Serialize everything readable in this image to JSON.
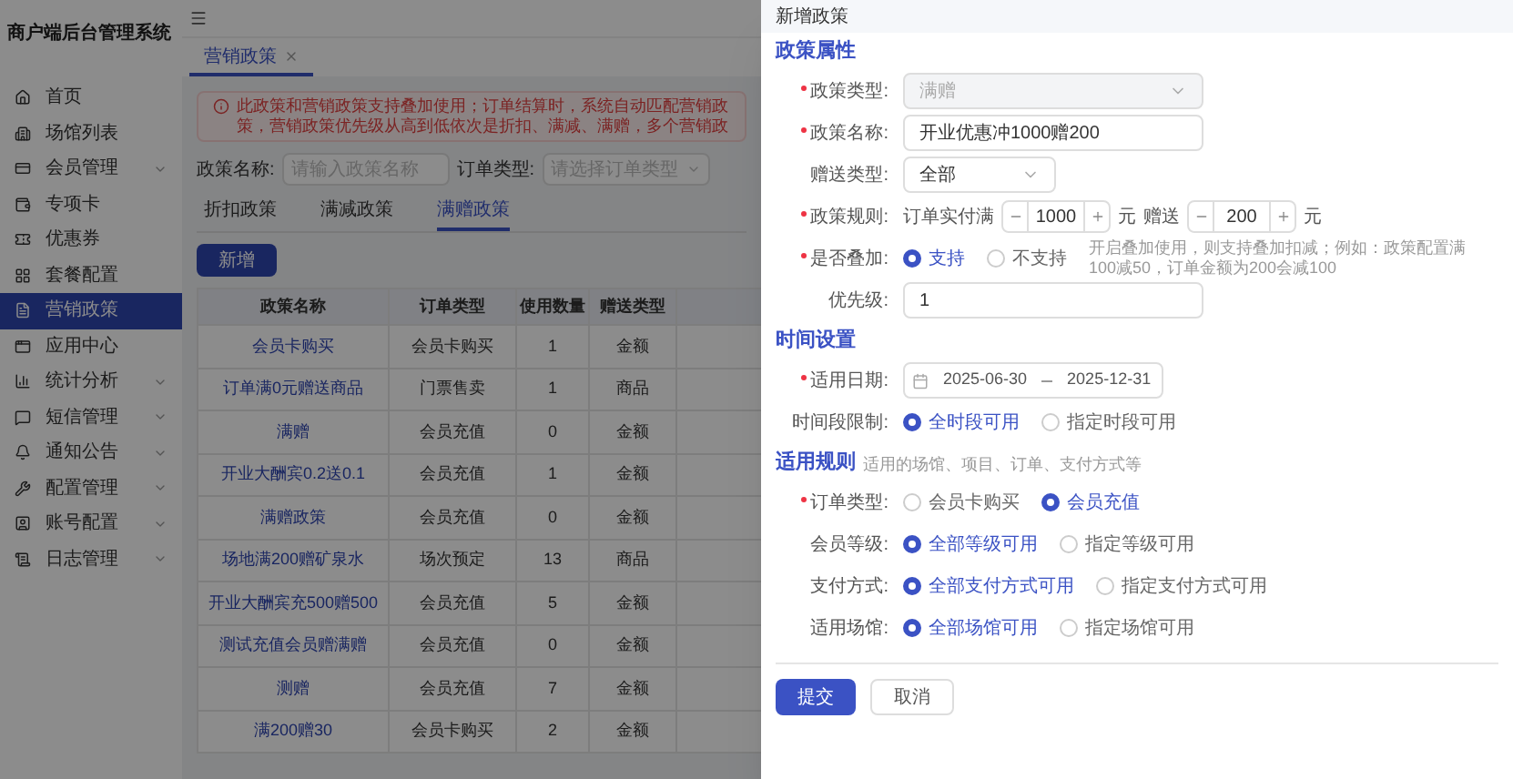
{
  "sidebar": {
    "title": "商户端后台管理系统",
    "items": [
      {
        "label": "首页",
        "expandable": false,
        "selected": false
      },
      {
        "label": "场馆列表",
        "expandable": false,
        "selected": false
      },
      {
        "label": "会员管理",
        "expandable": true,
        "selected": false
      },
      {
        "label": "专项卡",
        "expandable": false,
        "selected": false
      },
      {
        "label": "优惠券",
        "expandable": false,
        "selected": false
      },
      {
        "label": "套餐配置",
        "expandable": false,
        "selected": false
      },
      {
        "label": "营销政策",
        "expandable": false,
        "selected": true
      },
      {
        "label": "应用中心",
        "expandable": false,
        "selected": false
      },
      {
        "label": "统计分析",
        "expandable": true,
        "selected": false
      },
      {
        "label": "短信管理",
        "expandable": true,
        "selected": false
      },
      {
        "label": "通知公告",
        "expandable": true,
        "selected": false
      },
      {
        "label": "配置管理",
        "expandable": true,
        "selected": false
      },
      {
        "label": "账号配置",
        "expandable": true,
        "selected": false
      },
      {
        "label": "日志管理",
        "expandable": true,
        "selected": false
      }
    ]
  },
  "page_tabs": [
    {
      "label": "营销政策",
      "selected": true
    }
  ],
  "alert": "此政策和营销政策支持叠加使用；订单结算时，系统自动匹配营销政策，营销政策优先级从高到低依次是折扣、满减、满赠，多个营销政",
  "filters": [
    {
      "label": "政策名称:",
      "placeholder": "请输入政策名称",
      "kind": "input"
    },
    {
      "label": "订单类型:",
      "placeholder": "请选择订单类型",
      "kind": "select"
    }
  ],
  "policy_tabs": [
    {
      "label": "折扣政策",
      "selected": false
    },
    {
      "label": "满减政策",
      "selected": false
    },
    {
      "label": "满赠政策",
      "selected": true
    }
  ],
  "add_button": "新增",
  "table": {
    "columns": [
      "政策名称",
      "订单类型",
      "使用数量",
      "赠送类型"
    ],
    "rows": [
      [
        "会员卡购买",
        "会员卡购买",
        "1",
        "金额"
      ],
      [
        "订单满0元赠送商品",
        "门票售卖",
        "1",
        "商品"
      ],
      [
        "满赠",
        "会员充值",
        "0",
        "金额"
      ],
      [
        "开业大酬宾0.2送0.1",
        "会员充值",
        "1",
        "金额"
      ],
      [
        "满赠政策",
        "会员充值",
        "0",
        "金额"
      ],
      [
        "场地满200赠矿泉水",
        "场次预定",
        "13",
        "商品"
      ],
      [
        "开业大酬宾充500赠500",
        "会员充值",
        "5",
        "金额"
      ],
      [
        "测试充值会员赠满赠",
        "会员充值",
        "0",
        "金额"
      ],
      [
        "测赠",
        "会员充值",
        "7",
        "金额"
      ],
      [
        "满200赠30",
        "会员卡购买",
        "2",
        "金额"
      ]
    ]
  },
  "drawer": {
    "title": "新增政策",
    "sections": [
      {
        "title": "政策属性",
        "rows": [
          {
            "label": "政策类型:",
            "required": true,
            "kind": "select",
            "value": "满赠",
            "disabled": true
          },
          {
            "label": "政策名称:",
            "required": true,
            "kind": "input",
            "value": "开业优惠冲1000赠200"
          },
          {
            "label": "赠送类型:",
            "required": false,
            "kind": "select",
            "value": "全部",
            "disabled": false
          },
          {
            "label": "政策规则:",
            "required": true,
            "kind": "rule",
            "prefix": "订单实付满",
            "first_value": "1000",
            "unit": "元",
            "middle": "赠送",
            "second_value": "200",
            "unit2": "元"
          },
          {
            "label": "是否叠加:",
            "required": true,
            "kind": "radio",
            "options": [
              {
                "label": "支持",
                "selected": true
              },
              {
                "label": "不支持",
                "selected": false
              }
            ],
            "hint": "开启叠加使用，则支持叠加扣减；例如：政策配置满100减50，订单金额为200会减100"
          },
          {
            "label": "优先级:",
            "required": false,
            "kind": "input",
            "value": "1"
          }
        ]
      },
      {
        "title": "时间设置",
        "rows": [
          {
            "label": "适用日期:",
            "required": true,
            "kind": "date",
            "start": "2025-06-30",
            "end": "2025-12-31"
          },
          {
            "label": "时间段限制:",
            "required": false,
            "kind": "radio",
            "options": [
              {
                "label": "全时段可用",
                "selected": true
              },
              {
                "label": "指定时段可用",
                "selected": false
              }
            ]
          }
        ]
      },
      {
        "title": "适用规则",
        "hint": "适用的场馆、项目、订单、支付方式等",
        "rows": [
          {
            "label": "订单类型:",
            "required": true,
            "kind": "radio",
            "options": [
              {
                "label": "会员卡购买",
                "selected": false
              },
              {
                "label": "会员充值",
                "selected": true
              }
            ]
          },
          {
            "label": "会员等级:",
            "required": false,
            "kind": "radio",
            "options": [
              {
                "label": "全部等级可用",
                "selected": true
              },
              {
                "label": "指定等级可用",
                "selected": false
              }
            ]
          },
          {
            "label": "支付方式:",
            "required": false,
            "kind": "radio",
            "options": [
              {
                "label": "全部支付方式可用",
                "selected": true
              },
              {
                "label": "指定支付方式可用",
                "selected": false
              }
            ]
          },
          {
            "label": "适用场馆:",
            "required": false,
            "kind": "radio",
            "options": [
              {
                "label": "全部场馆可用",
                "selected": true
              },
              {
                "label": "指定场馆可用",
                "selected": false
              }
            ]
          }
        ]
      }
    ],
    "buttons": [
      {
        "label": "提交",
        "kind": "primary"
      },
      {
        "label": "取消",
        "kind": "default"
      }
    ]
  }
}
